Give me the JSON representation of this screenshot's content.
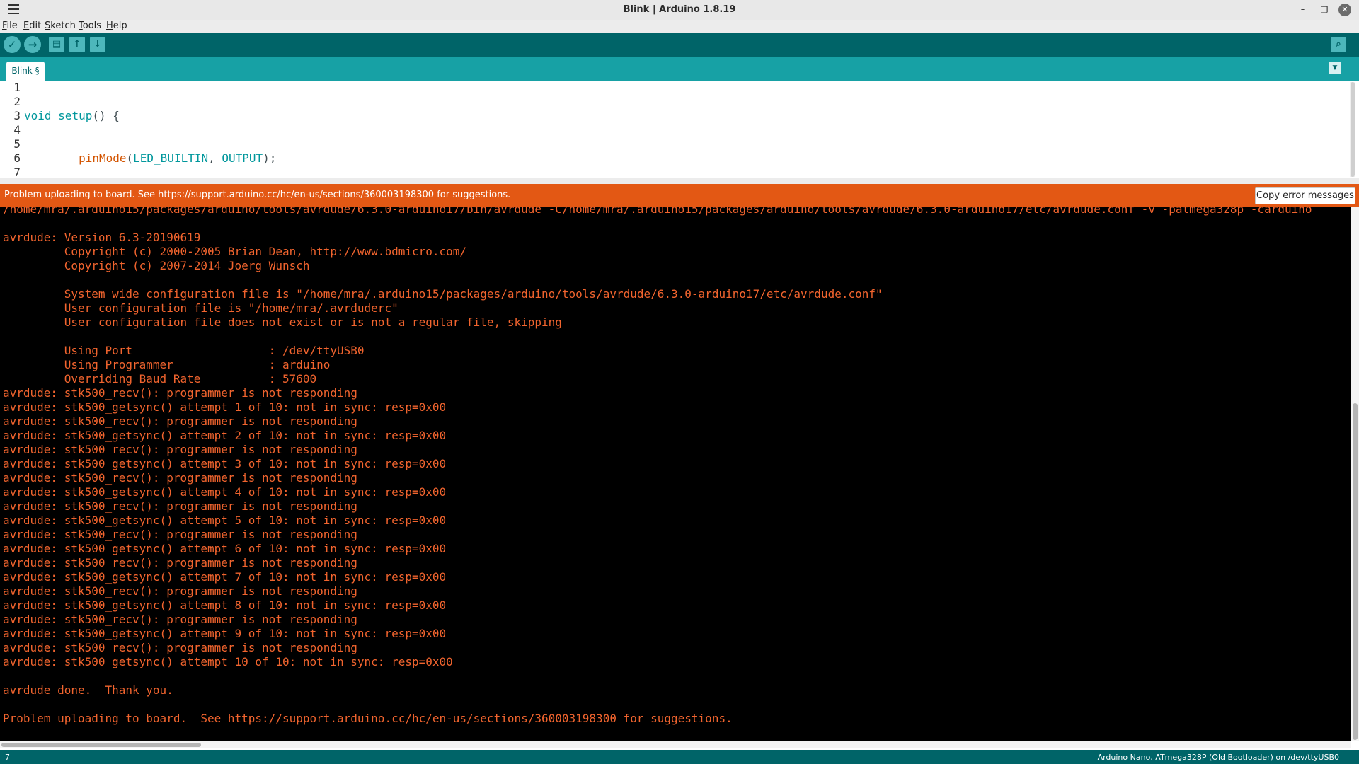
{
  "window": {
    "title": "Blink | Arduino 1.8.19",
    "minimize": "–",
    "maximize": "❐",
    "close": "✕"
  },
  "menu": [
    "File",
    "Edit",
    "Sketch",
    "Tools",
    "Help"
  ],
  "toolbar": {
    "verify_icon": "✓",
    "upload_icon": "→",
    "new_icon": "▤",
    "open_icon": "↑",
    "save_icon": "↓",
    "serial_icon": "⌕"
  },
  "tab": {
    "label": "Blink §",
    "menu_icon": "▼"
  },
  "editor": {
    "line_numbers": [
      "1",
      "2",
      "3",
      "4",
      "5",
      "6",
      "7"
    ]
  },
  "error_bar": {
    "message": "Problem uploading to board.  See https://support.arduino.cc/hc/en-us/sections/360003198300 for suggestions.",
    "copy_button": "Copy error messages"
  },
  "console": {
    "lines": [
      "/home/mra/.arduino15/packages/arduino/tools/avrdude/6.3.0-arduino17/bin/avrdude -C/home/mra/.arduino15/packages/arduino/tools/avrdude/6.3.0-arduino17/etc/avrdude.conf -v -patmega328p -carduino",
      "",
      "avrdude: Version 6.3-20190619",
      "         Copyright (c) 2000-2005 Brian Dean, http://www.bdmicro.com/",
      "         Copyright (c) 2007-2014 Joerg Wunsch",
      "",
      "         System wide configuration file is \"/home/mra/.arduino15/packages/arduino/tools/avrdude/6.3.0-arduino17/etc/avrdude.conf\"",
      "         User configuration file is \"/home/mra/.avrduderc\"",
      "         User configuration file does not exist or is not a regular file, skipping",
      "",
      "         Using Port                    : /dev/ttyUSB0",
      "         Using Programmer              : arduino",
      "         Overriding Baud Rate          : 57600",
      "avrdude: stk500_recv(): programmer is not responding",
      "avrdude: stk500_getsync() attempt 1 of 10: not in sync: resp=0x00",
      "avrdude: stk500_recv(): programmer is not responding",
      "avrdude: stk500_getsync() attempt 2 of 10: not in sync: resp=0x00",
      "avrdude: stk500_recv(): programmer is not responding",
      "avrdude: stk500_getsync() attempt 3 of 10: not in sync: resp=0x00",
      "avrdude: stk500_recv(): programmer is not responding",
      "avrdude: stk500_getsync() attempt 4 of 10: not in sync: resp=0x00",
      "avrdude: stk500_recv(): programmer is not responding",
      "avrdude: stk500_getsync() attempt 5 of 10: not in sync: resp=0x00",
      "avrdude: stk500_recv(): programmer is not responding",
      "avrdude: stk500_getsync() attempt 6 of 10: not in sync: resp=0x00",
      "avrdude: stk500_recv(): programmer is not responding",
      "avrdude: stk500_getsync() attempt 7 of 10: not in sync: resp=0x00",
      "avrdude: stk500_recv(): programmer is not responding",
      "avrdude: stk500_getsync() attempt 8 of 10: not in sync: resp=0x00",
      "avrdude: stk500_recv(): programmer is not responding",
      "avrdude: stk500_getsync() attempt 9 of 10: not in sync: resp=0x00",
      "avrdude: stk500_recv(): programmer is not responding",
      "avrdude: stk500_getsync() attempt 10 of 10: not in sync: resp=0x00",
      "",
      "avrdude done.  Thank you.",
      "",
      "Problem uploading to board.  See https://support.arduino.cc/hc/en-us/sections/360003198300 for suggestions."
    ]
  },
  "status_bar": {
    "line": "7",
    "board": "Arduino Nano, ATmega328P (Old Bootloader) on /dev/ttyUSB0"
  },
  "colors": {
    "toolbar": "#006468",
    "tabbar": "#17a1a5",
    "error_bar": "#e35814",
    "console_text": "#f1642e",
    "console_bg": "#000000"
  }
}
